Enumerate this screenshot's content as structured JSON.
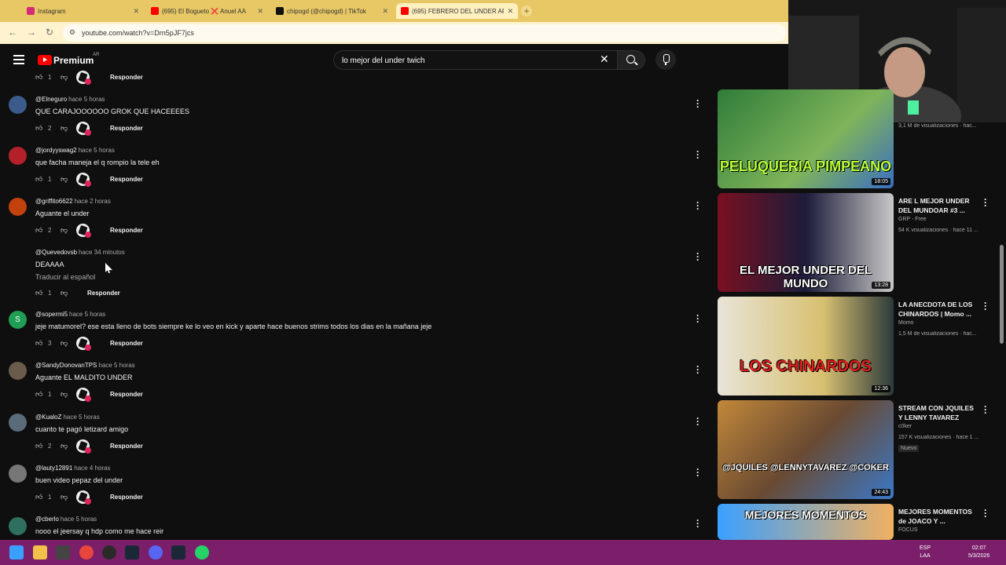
{
  "browser": {
    "tabs": [
      {
        "label": "Instagram",
        "color": "#d62976"
      },
      {
        "label": "(695) El Bogueto ❌ Anuel AA",
        "color": "#ff0000"
      },
      {
        "label": "chipogd (@chipogd) | TikTok",
        "color": "#111111"
      },
      {
        "label": "(695) FEBRERO DEL UNDER AR",
        "color": "#ff0000"
      }
    ],
    "new_tab": "+",
    "url": "youtube.com/watch?v=Drn5pJF7jcs"
  },
  "youtube": {
    "logo_text": "Premium",
    "country": "AR",
    "search_value": "lo mejor del under twich"
  },
  "comments": [
    {
      "author": "",
      "time": "",
      "text": "",
      "likes": "1",
      "reply": "Responder",
      "partial": true
    },
    {
      "author": "@Elneguro",
      "time": "hace 5 horas",
      "text": "QUE CARAJOOOOOO GROK QUE HACEEEES",
      "likes": "2",
      "reply": "Responder"
    },
    {
      "author": "@jordyyswag2",
      "time": "hace 5 horas",
      "text": "que facha maneja el q rompio la tele eh",
      "likes": "1",
      "reply": "Responder"
    },
    {
      "author": "@griffito6622",
      "time": "hace 2 horas",
      "text": "Aguante el under",
      "likes": "2",
      "reply": "Responder"
    },
    {
      "author": "@Quevedovsb",
      "time": "hace 34 minutos",
      "text": "DEAAAA",
      "translate": "Traducir al español",
      "likes": "1",
      "reply": "Responder"
    },
    {
      "author": "@sopermi5",
      "time": "hace 5 horas",
      "text": "jeje matumorel? ese esta lleno de bots siempre ke lo veo en kick y aparte hace buenos strims todos los dias en la mañana jeje",
      "likes": "3",
      "reply": "Responder",
      "avatar_letter": "S"
    },
    {
      "author": "@SandyDonovanTPS",
      "time": "hace 5 horas",
      "text": "Aguante EL MALDITO UNDER",
      "likes": "1",
      "reply": "Responder"
    },
    {
      "author": "@KualoZ",
      "time": "hace 5 horas",
      "text": "cuanto te pagó letizard amigo",
      "likes": "2",
      "reply": "Responder"
    },
    {
      "author": "@lauty12891",
      "time": "hace 4 horas",
      "text": "buen video pepaz del under",
      "likes": "1",
      "reply": "Responder"
    },
    {
      "author": "@cberlo",
      "time": "hace 5 horas",
      "text": "nooo el jeersay q hdp como me hace reir",
      "likes": "",
      "reply": ""
    }
  ],
  "videos": [
    {
      "thumb_text": "PELUQUERIA PIMPEANO",
      "duration": "18:05",
      "title": "",
      "channel": "",
      "meta": "3,1 M de visualizaciones · hac..."
    },
    {
      "thumb_text": "EL MEJOR UNDER DEL MUNDO",
      "duration": "13:28",
      "title": "ARE L MEJOR UNDER DEL MUNDOAR #3 ...",
      "channel": "GRP - Free",
      "meta": "54 K visualizaciones · hace 11 ..."
    },
    {
      "thumb_text": "LOS CHINARDOS",
      "duration": "12:36",
      "title": "LA ANECDOTA DE LOS CHINARDOS | Momo ...",
      "channel": "Momo",
      "meta": "1,5 M de visualizaciones · hac..."
    },
    {
      "thumb_text": "@JQUILES @LENNYTAVAREZ @COKER",
      "duration": "24:43",
      "title": "STREAM CON JQUILES Y LENNY TAVAREZ",
      "channel": "c0ker",
      "meta": "157 K visualizaciones · hace 1 ...",
      "badge": "Nuevo"
    },
    {
      "thumb_text": "MEJORES MOMENTOS",
      "duration": "",
      "title": "MEJORES MOMENTOS de JOACO Y ...",
      "channel": "FOCUS",
      "meta": ""
    }
  ],
  "taskbar": {
    "lang_top": "ESP",
    "lang_bottom": "LAA",
    "time": "02:07",
    "date": "5/3/2026"
  },
  "colors": {
    "background": "#0f0f0f",
    "tabbar": "#e8c864",
    "taskbar": "#7b1f6a",
    "accent": "#ff0000"
  }
}
